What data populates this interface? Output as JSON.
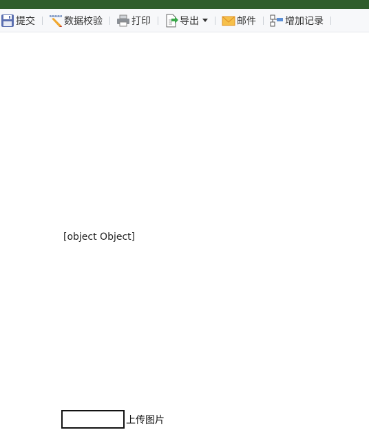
{
  "toolbar": {
    "items": [
      {
        "label": "提交",
        "icon": "save-icon"
      },
      {
        "label": "数据校验",
        "icon": "pencil-ruler-icon"
      },
      {
        "label": "打印",
        "icon": "printer-icon"
      },
      {
        "label": "导出",
        "icon": "export-icon",
        "has_dropdown": true
      },
      {
        "label": "邮件",
        "icon": "mail-icon"
      },
      {
        "label": "增加记录",
        "icon": "add-record-icon"
      }
    ]
  },
  "main": {
    "object_text": "[object Object]"
  },
  "upload": {
    "label": "上传图片"
  },
  "colors": {
    "header_bar": "#2f5d2c",
    "toolbar_bg": "#f7f8fa",
    "mail_icon": "#f0a830",
    "export_icon": "#3aa84a"
  }
}
